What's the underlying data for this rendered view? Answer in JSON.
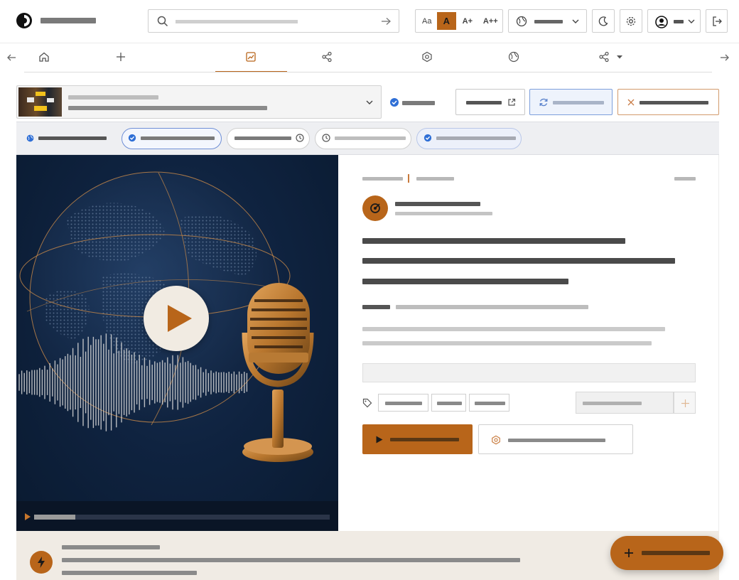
{
  "header": {
    "font_sizes": [
      "Aa",
      "A",
      "A+",
      "A++"
    ],
    "active_font_size": "A"
  },
  "nav": {
    "active_index": 2,
    "icons": [
      "home-icon",
      "plus-icon",
      "chart-line-icon",
      "share-nodes-icon",
      "ai-hexagon-icon",
      "globe-icon",
      "share-dropdown-icon"
    ]
  },
  "player": {
    "progress": 0.14
  },
  "colors": {
    "accent": "#b8651a",
    "navy": "#0f2340",
    "selected_blue": "#2f6fd6",
    "bottom_band": "#f0ebe4"
  }
}
